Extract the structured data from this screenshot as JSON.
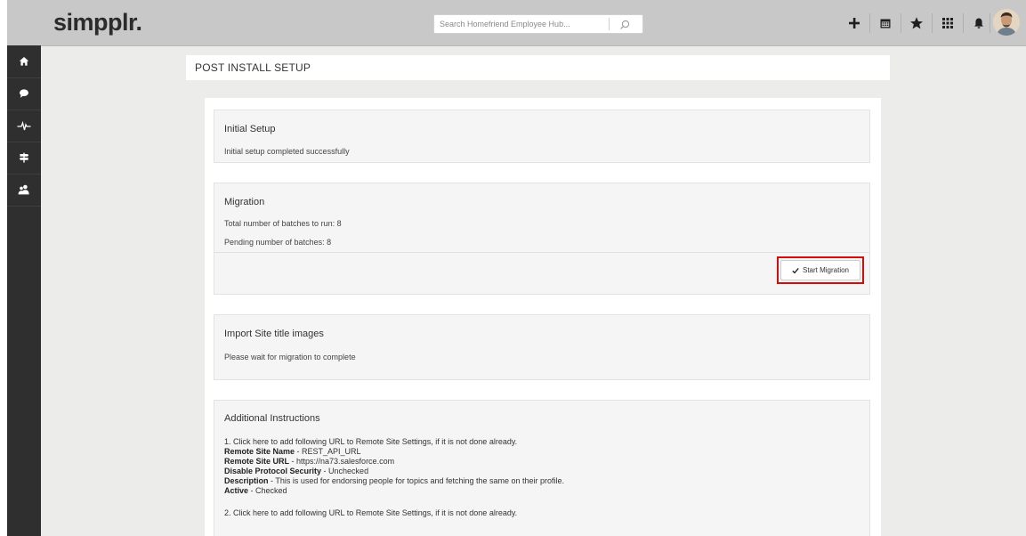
{
  "header": {
    "logo": "simpplr.",
    "search": {
      "placeholder": "Search Homefriend Employee Hub..."
    },
    "icons": [
      "plus-icon",
      "calendar-icon",
      "star-icon",
      "apps-grid-icon",
      "bell-icon"
    ]
  },
  "rail": {
    "icons": [
      "home-icon",
      "chat-icon",
      "pulse-icon",
      "signpost-icon",
      "people-icon"
    ]
  },
  "page_title": "POST INSTALL SETUP",
  "initial_setup": {
    "title": "Initial Setup",
    "status": "Initial setup completed successfully"
  },
  "migration": {
    "title": "Migration",
    "total_batches": "Total number of batches to run: 8",
    "pending_batches": "Pending number of batches: 8",
    "start_button": "Start Migration"
  },
  "import_images": {
    "title": "Import Site title images",
    "status": "Please wait for migration to complete"
  },
  "instructions": {
    "title": "Additional Instructions",
    "step1": "1. Click here to add following URL to Remote Site Settings, if it is not done already.",
    "remote_site_name_label": "Remote Site Name",
    "remote_site_name_value": " - REST_API_URL",
    "remote_site_url_label": "Remote Site URL",
    "remote_site_url_value": " - https://na73.salesforce.com",
    "protocol_label": "Disable Protocol Security",
    "protocol_value": " - Unchecked",
    "description_label": "Description",
    "description_value": " - This is used for endorsing people for topics and fetching the same on their profile.",
    "active_label": "Active",
    "active_value": " - Checked",
    "step2": "2. Click here to add following URL to Remote Site Settings, if it is not done already."
  },
  "colors": {
    "header_bg": "#c8c8c8",
    "rail_bg": "#2f2f2f",
    "highlight": "#d40c0c"
  }
}
